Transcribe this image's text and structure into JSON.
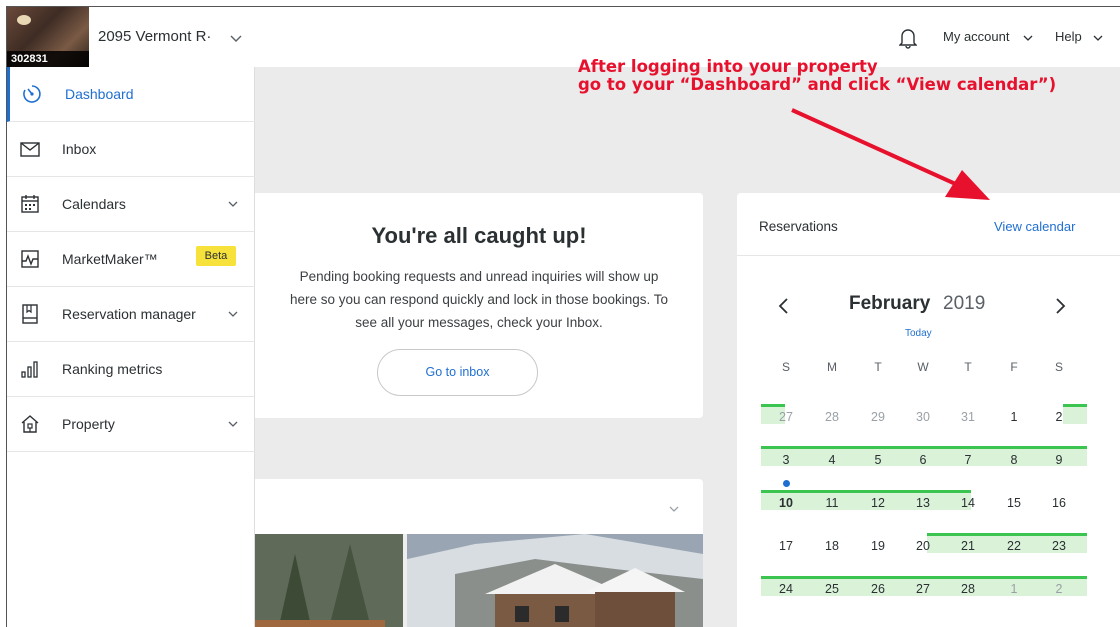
{
  "header": {
    "property_id": "302831",
    "property_name": "2095 Vermont R·",
    "my_account": "My account",
    "help": "Help"
  },
  "sidebar": {
    "items": [
      {
        "label": "Dashboard",
        "icon": "dashboard-icon",
        "active": true
      },
      {
        "label": "Inbox",
        "icon": "envelope-icon"
      },
      {
        "label": "Calendars",
        "icon": "calendar-icon",
        "chevron": true
      },
      {
        "label": "MarketMaker™",
        "icon": "pulse-icon",
        "badge": "Beta"
      },
      {
        "label": "Reservation manager",
        "icon": "book-icon",
        "chevron": true
      },
      {
        "label": "Ranking metrics",
        "icon": "bar-chart-icon"
      },
      {
        "label": "Property",
        "icon": "house-icon",
        "chevron": true
      }
    ]
  },
  "main": {
    "caught_up_title": "You're all caught up!",
    "caught_up_line1": "Pending booking requests and unread inquiries will show up",
    "caught_up_line2": "here so you can respond quickly and lock in those bookings. To",
    "caught_up_line3": "see all your messages, check your Inbox.",
    "go_to_inbox": "Go to inbox"
  },
  "reservations": {
    "title": "Reservations",
    "view_calendar": "View calendar",
    "month": "February",
    "year": "2019",
    "today_label": "Today",
    "weekdays": [
      "S",
      "M",
      "T",
      "W",
      "T",
      "F",
      "S"
    ],
    "weeks": [
      [
        "27",
        "28",
        "29",
        "30",
        "31",
        "1",
        "2"
      ],
      [
        "3",
        "4",
        "5",
        "6",
        "7",
        "8",
        "9"
      ],
      [
        "10",
        "11",
        "12",
        "13",
        "14",
        "15",
        "16"
      ],
      [
        "17",
        "18",
        "19",
        "20",
        "21",
        "22",
        "23"
      ],
      [
        "24",
        "25",
        "26",
        "27",
        "28",
        "1",
        "2"
      ]
    ]
  },
  "annotation": {
    "line1": "After logging into your property",
    "line2": "go to your “Dashboard” and click “View calendar”)"
  },
  "colors": {
    "accent": "#1f6fd1",
    "booking_bar": "#d9f2d8",
    "booking_edge": "#3cc451",
    "beta_badge": "#f7e23b",
    "annotation": "#e8112d"
  }
}
